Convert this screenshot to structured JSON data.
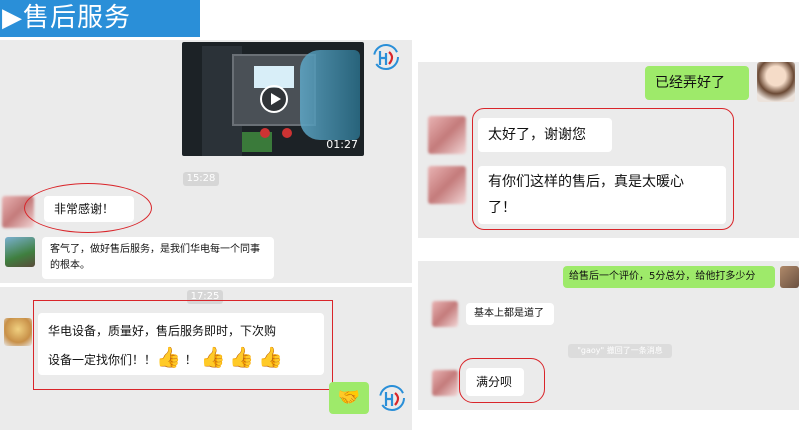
{
  "banner": {
    "arrow": "▶",
    "title": "售后服务"
  },
  "left_chat": {
    "video": {
      "duration": "01:27"
    },
    "time_1": "15:28",
    "msg_thanks": "非常感谢！",
    "msg_reply": "客气了，做好售后服务，是我们华电每一个同事的根本。",
    "time_2": "17:25",
    "msg_review_line1": "华电设备，质量好，售后服务即时，下次购",
    "msg_review_line2": "设备一定找你们！！",
    "msg_review_excl": "！"
  },
  "right_top_chat": {
    "msg_done": "已经弄好了",
    "msg_thanks": "太好了，谢谢您",
    "msg_warm_line1": "有你们这样的售后，真是太暖心",
    "msg_warm_line2": "了！"
  },
  "right_bottom_chat": {
    "msg_request": "给售后一个评价，5分总分，给他打多少分",
    "msg_basic": "基本上都是道了",
    "system_notice": "\"gaoy\" 撤回了一条消息",
    "msg_full": "满分呗"
  },
  "colors": {
    "accent_blue": "#2a8fd8",
    "highlight_red": "#d9252a",
    "bubble_green": "#9eea6a",
    "chat_bg": "#ebebeb"
  }
}
